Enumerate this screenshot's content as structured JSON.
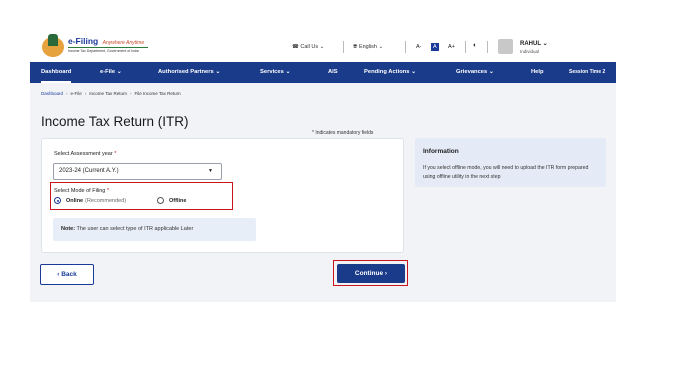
{
  "header": {
    "logo_title": "e-Filing",
    "logo_tagline": "Anywhere Anytime",
    "logo_subtitle": "Income Tax Department, Government of India",
    "call_us": "Call Us",
    "language": "English",
    "font_small": "A-",
    "font_normal": "A",
    "font_large": "A+",
    "user_name": "RAHUL",
    "user_role": "Individual"
  },
  "nav": {
    "items": [
      {
        "label": "Dashboard"
      },
      {
        "label": "e-File"
      },
      {
        "label": "Authorised Partners"
      },
      {
        "label": "Services"
      },
      {
        "label": "AIS"
      },
      {
        "label": "Pending Actions"
      },
      {
        "label": "Grievances"
      },
      {
        "label": "Help"
      },
      {
        "label": "Session Time"
      }
    ],
    "session_digit": "2"
  },
  "breadcrumb": [
    "Dashboard",
    "e-File",
    "Income Tax Return",
    "File Income Tax Return"
  ],
  "page_title": "Income Tax Return (ITR)",
  "mandatory_note": "* Indicates mandatory fields",
  "form": {
    "assessment_label": "Select Assessment year",
    "assessment_value": "2023-24 (Current A.Y.)",
    "mode_label": "Select Mode of Filing",
    "online_label": "Online",
    "online_hint": "(Recommended)",
    "offline_label": "Offline",
    "note_title": "Note:",
    "note_text": "The user can select type of ITR applicable Later"
  },
  "info": {
    "title": "Information",
    "body": "If you select offline mode, you will need to upload the ITR form prepared using offline utility in the next step"
  },
  "actions": {
    "back": "Back",
    "continue": "Continue"
  },
  "colors": {
    "nav_bg": "#1a3a8a",
    "highlight": "#c8141c",
    "info_bg": "#e4ebf6"
  }
}
